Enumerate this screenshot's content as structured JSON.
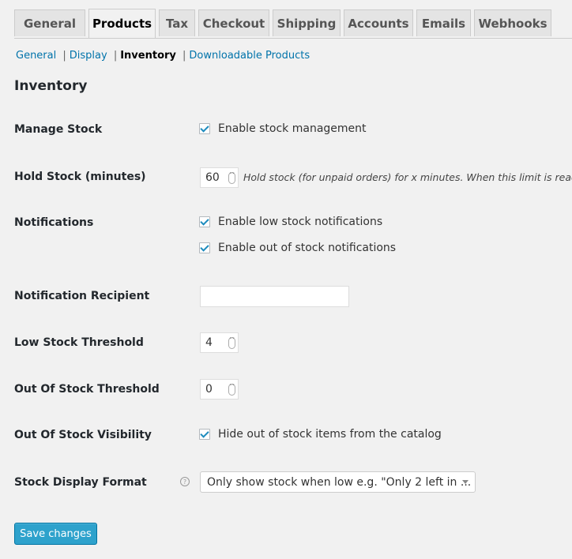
{
  "tabs": [
    {
      "label": "General",
      "active": false
    },
    {
      "label": "Products",
      "active": true
    },
    {
      "label": "Tax",
      "active": false
    },
    {
      "label": "Checkout",
      "active": false
    },
    {
      "label": "Shipping",
      "active": false
    },
    {
      "label": "Accounts",
      "active": false
    },
    {
      "label": "Emails",
      "active": false
    },
    {
      "label": "Webhooks",
      "active": false
    }
  ],
  "subnav": {
    "items": [
      "General",
      "Display",
      "Inventory",
      "Downloadable Products"
    ],
    "current": "Inventory",
    "separator": "|"
  },
  "section_title": "Inventory",
  "fields": {
    "manage_stock": {
      "label": "Manage Stock",
      "checkbox_label": "Enable stock management",
      "checked": true
    },
    "hold_stock": {
      "label": "Hold Stock (minutes)",
      "value": "60",
      "description": "Hold stock (for unpaid orders) for x minutes. When this limit is reached, th"
    },
    "notifications": {
      "label": "Notifications",
      "options": [
        {
          "label": "Enable low stock notifications",
          "checked": true
        },
        {
          "label": "Enable out of stock notifications",
          "checked": true
        }
      ]
    },
    "notification_recipient": {
      "label": "Notification Recipient",
      "value": ""
    },
    "low_stock_threshold": {
      "label": "Low Stock Threshold",
      "value": "4"
    },
    "out_of_stock_threshold": {
      "label": "Out Of Stock Threshold",
      "value": "0"
    },
    "out_of_stock_visibility": {
      "label": "Out Of Stock Visibility",
      "checkbox_label": "Hide out of stock items from the catalog",
      "checked": true
    },
    "stock_display_format": {
      "label": "Stock Display Format",
      "help_icon": "?",
      "selected": "Only show stock when low e.g. \"Only 2 left in ..."
    }
  },
  "save_button": {
    "label": "Save changes"
  },
  "spinner_glyph": "˄˅",
  "colors": {
    "link": "#0073aa",
    "primary_button": "#2ea2cc",
    "checkmark": "#1e8cbe"
  }
}
